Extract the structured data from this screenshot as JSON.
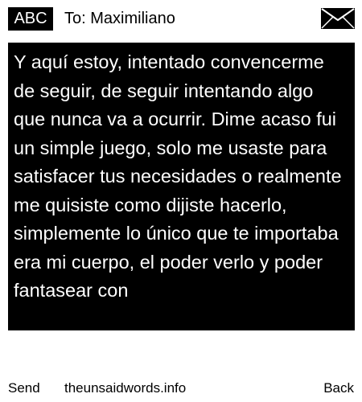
{
  "header": {
    "badge": "ABC",
    "recipient": "To: Maximiliano",
    "icon": "envelope-icon"
  },
  "message": {
    "text": "Y aquí estoy, intentado convencerme de seguir, de seguir intentando algo que nunca va a ocurrir. Dime acaso fui un simple juego, solo me usaste para satisfacer tus necesidades o realmente me quisiste como dijiste hacerlo, simplemente lo único que te importaba era mi cuerpo, el poder verlo y poder fantasear con"
  },
  "footer": {
    "send": "Send",
    "site": "theunsaidwords.info",
    "back": "Back"
  },
  "colors": {
    "background": "#ffffff",
    "ink": "#000000",
    "message_text": "#ffffff"
  }
}
